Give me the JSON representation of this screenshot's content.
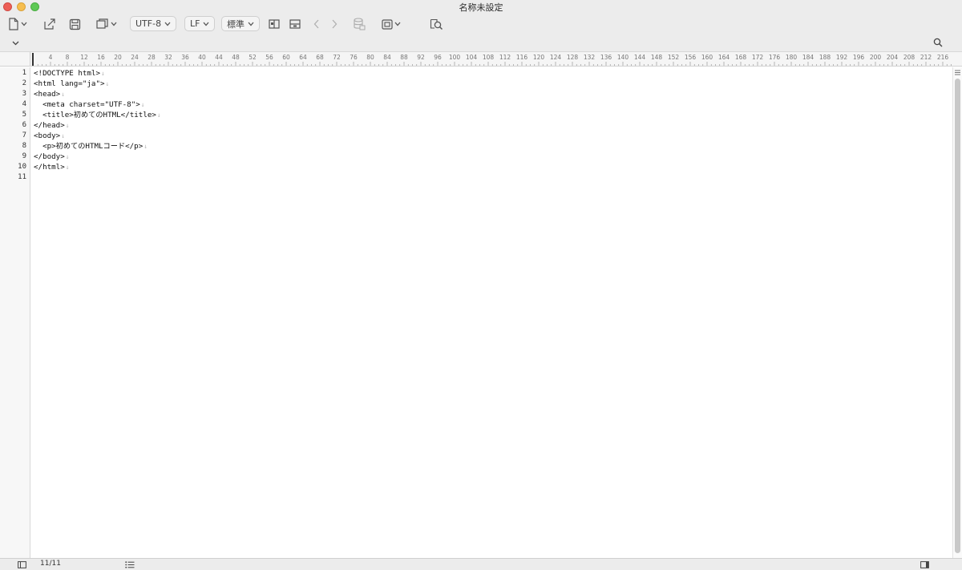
{
  "window": {
    "title": "名称未設定"
  },
  "toolbar": {
    "encoding": "UTF-8",
    "line_ending": "LF",
    "syntax": "標準"
  },
  "ruler": {
    "ticks": [
      "4",
      "8",
      "12",
      "16",
      "20",
      "24",
      "28",
      "32",
      "36",
      "40",
      "44",
      "48",
      "52",
      "56",
      "60",
      "64",
      "68",
      "72",
      "76",
      "80",
      "84",
      "88",
      "92",
      "96",
      "100",
      "104",
      "108",
      "112",
      "116",
      "120",
      "124",
      "128",
      "132",
      "136",
      "140",
      "144",
      "148",
      "152",
      "156",
      "160",
      "164",
      "168",
      "172",
      "176",
      "180",
      "184",
      "188",
      "192",
      "196",
      "200",
      "204",
      "208",
      "212",
      "216"
    ]
  },
  "editor": {
    "line_numbers": [
      "1",
      "2",
      "3",
      "4",
      "5",
      "6",
      "7",
      "8",
      "9",
      "10",
      "11"
    ],
    "lines": [
      "<!DOCTYPE html>",
      "<html lang=\"ja\">",
      "<head>",
      "  <meta charset=\"UTF-8\">",
      "  <title>初めてのHTML</title>",
      "</head>",
      "<body>",
      "  <p>初めてのHTMLコード</p>",
      "</body>",
      "</html>",
      ""
    ],
    "eol_mark": "↓"
  },
  "status": {
    "position": "11/11"
  },
  "icons": {
    "new_document": "new-document-icon",
    "share": "share-icon",
    "save": "save-icon",
    "duplicate": "duplicate-icon",
    "split_vertical": "split-vertical-icon",
    "split_horizontal": "split-horizontal-icon",
    "back": "chevron-left-icon",
    "forward": "chevron-right-icon",
    "database": "database-icon",
    "panel": "panel-icon",
    "find": "find-document-icon",
    "search": "search-icon",
    "sidebar": "sidebar-icon",
    "outline": "list-icon",
    "inspector": "inspector-icon"
  }
}
